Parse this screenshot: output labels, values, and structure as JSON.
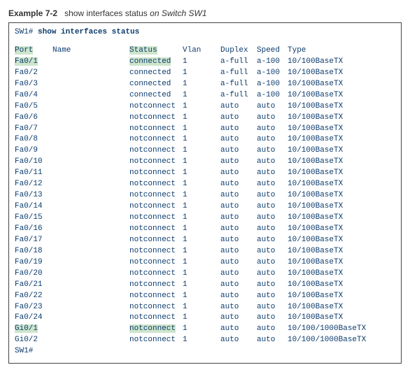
{
  "example": {
    "prefix": "Example 7-2",
    "middle": "show interfaces status",
    "suffix_on": "on",
    "suffix_dev": "Switch SW1"
  },
  "prompt": "SW1#",
  "command": "show interfaces status",
  "headers": {
    "port": "Port",
    "name": "Name",
    "status": "Status",
    "vlan": "Vlan",
    "duplex": "Duplex",
    "speed": "Speed",
    "type": "Type"
  },
  "rows": [
    {
      "port": "Fa0/1",
      "name": "",
      "status": "connected",
      "vlan": "1",
      "duplex": "a-full",
      "speed": "a-100",
      "type": "10/100BaseTX",
      "hl_port": true,
      "hl_status": true
    },
    {
      "port": "Fa0/2",
      "name": "",
      "status": "connected",
      "vlan": "1",
      "duplex": "a-full",
      "speed": "a-100",
      "type": "10/100BaseTX",
      "hl_port": false,
      "hl_status": false
    },
    {
      "port": "Fa0/3",
      "name": "",
      "status": "connected",
      "vlan": "1",
      "duplex": "a-full",
      "speed": "a-100",
      "type": "10/100BaseTX",
      "hl_port": false,
      "hl_status": false
    },
    {
      "port": "Fa0/4",
      "name": "",
      "status": "connected",
      "vlan": "1",
      "duplex": "a-full",
      "speed": "a-100",
      "type": "10/100BaseTX",
      "hl_port": false,
      "hl_status": false
    },
    {
      "port": "Fa0/5",
      "name": "",
      "status": "notconnect",
      "vlan": "1",
      "duplex": "auto",
      "speed": "auto",
      "type": "10/100BaseTX",
      "hl_port": false,
      "hl_status": false
    },
    {
      "port": "Fa0/6",
      "name": "",
      "status": "notconnect",
      "vlan": "1",
      "duplex": "auto",
      "speed": "auto",
      "type": "10/100BaseTX",
      "hl_port": false,
      "hl_status": false
    },
    {
      "port": "Fa0/7",
      "name": "",
      "status": "notconnect",
      "vlan": "1",
      "duplex": "auto",
      "speed": "auto",
      "type": "10/100BaseTX",
      "hl_port": false,
      "hl_status": false
    },
    {
      "port": "Fa0/8",
      "name": "",
      "status": "notconnect",
      "vlan": "1",
      "duplex": "auto",
      "speed": "auto",
      "type": "10/100BaseTX",
      "hl_port": false,
      "hl_status": false
    },
    {
      "port": "Fa0/9",
      "name": "",
      "status": "notconnect",
      "vlan": "1",
      "duplex": "auto",
      "speed": "auto",
      "type": "10/100BaseTX",
      "hl_port": false,
      "hl_status": false
    },
    {
      "port": "Fa0/10",
      "name": "",
      "status": "notconnect",
      "vlan": "1",
      "duplex": "auto",
      "speed": "auto",
      "type": "10/100BaseTX",
      "hl_port": false,
      "hl_status": false
    },
    {
      "port": "Fa0/11",
      "name": "",
      "status": "notconnect",
      "vlan": "1",
      "duplex": "auto",
      "speed": "auto",
      "type": "10/100BaseTX",
      "hl_port": false,
      "hl_status": false
    },
    {
      "port": "Fa0/12",
      "name": "",
      "status": "notconnect",
      "vlan": "1",
      "duplex": "auto",
      "speed": "auto",
      "type": "10/100BaseTX",
      "hl_port": false,
      "hl_status": false
    },
    {
      "port": "Fa0/13",
      "name": "",
      "status": "notconnect",
      "vlan": "1",
      "duplex": "auto",
      "speed": "auto",
      "type": "10/100BaseTX",
      "hl_port": false,
      "hl_status": false
    },
    {
      "port": "Fa0/14",
      "name": "",
      "status": "notconnect",
      "vlan": "1",
      "duplex": "auto",
      "speed": "auto",
      "type": "10/100BaseTX",
      "hl_port": false,
      "hl_status": false
    },
    {
      "port": "Fa0/15",
      "name": "",
      "status": "notconnect",
      "vlan": "1",
      "duplex": "auto",
      "speed": "auto",
      "type": "10/100BaseTX",
      "hl_port": false,
      "hl_status": false
    },
    {
      "port": "Fa0/16",
      "name": "",
      "status": "notconnect",
      "vlan": "1",
      "duplex": "auto",
      "speed": "auto",
      "type": "10/100BaseTX",
      "hl_port": false,
      "hl_status": false
    },
    {
      "port": "Fa0/17",
      "name": "",
      "status": "notconnect",
      "vlan": "1",
      "duplex": "auto",
      "speed": "auto",
      "type": "10/100BaseTX",
      "hl_port": false,
      "hl_status": false
    },
    {
      "port": "Fa0/18",
      "name": "",
      "status": "notconnect",
      "vlan": "1",
      "duplex": "auto",
      "speed": "auto",
      "type": "10/100BaseTX",
      "hl_port": false,
      "hl_status": false
    },
    {
      "port": "Fa0/19",
      "name": "",
      "status": "notconnect",
      "vlan": "1",
      "duplex": "auto",
      "speed": "auto",
      "type": "10/100BaseTX",
      "hl_port": false,
      "hl_status": false
    },
    {
      "port": "Fa0/20",
      "name": "",
      "status": "notconnect",
      "vlan": "1",
      "duplex": "auto",
      "speed": "auto",
      "type": "10/100BaseTX",
      "hl_port": false,
      "hl_status": false
    },
    {
      "port": "Fa0/21",
      "name": "",
      "status": "notconnect",
      "vlan": "1",
      "duplex": "auto",
      "speed": "auto",
      "type": "10/100BaseTX",
      "hl_port": false,
      "hl_status": false
    },
    {
      "port": "Fa0/22",
      "name": "",
      "status": "notconnect",
      "vlan": "1",
      "duplex": "auto",
      "speed": "auto",
      "type": "10/100BaseTX",
      "hl_port": false,
      "hl_status": false
    },
    {
      "port": "Fa0/23",
      "name": "",
      "status": "notconnect",
      "vlan": "1",
      "duplex": "auto",
      "speed": "auto",
      "type": "10/100BaseTX",
      "hl_port": false,
      "hl_status": false
    },
    {
      "port": "Fa0/24",
      "name": "",
      "status": "notconnect",
      "vlan": "1",
      "duplex": "auto",
      "speed": "auto",
      "type": "10/100BaseTX",
      "hl_port": false,
      "hl_status": false
    },
    {
      "port": "Gi0/1",
      "name": "",
      "status": "notconnect",
      "vlan": "1",
      "duplex": "auto",
      "speed": "auto",
      "type": "10/100/1000BaseTX",
      "hl_port": true,
      "hl_status": true
    },
    {
      "port": "Gi0/2",
      "name": "",
      "status": "notconnect",
      "vlan": "1",
      "duplex": "auto",
      "speed": "auto",
      "type": "10/100/1000BaseTX",
      "hl_port": false,
      "hl_status": false
    }
  ]
}
